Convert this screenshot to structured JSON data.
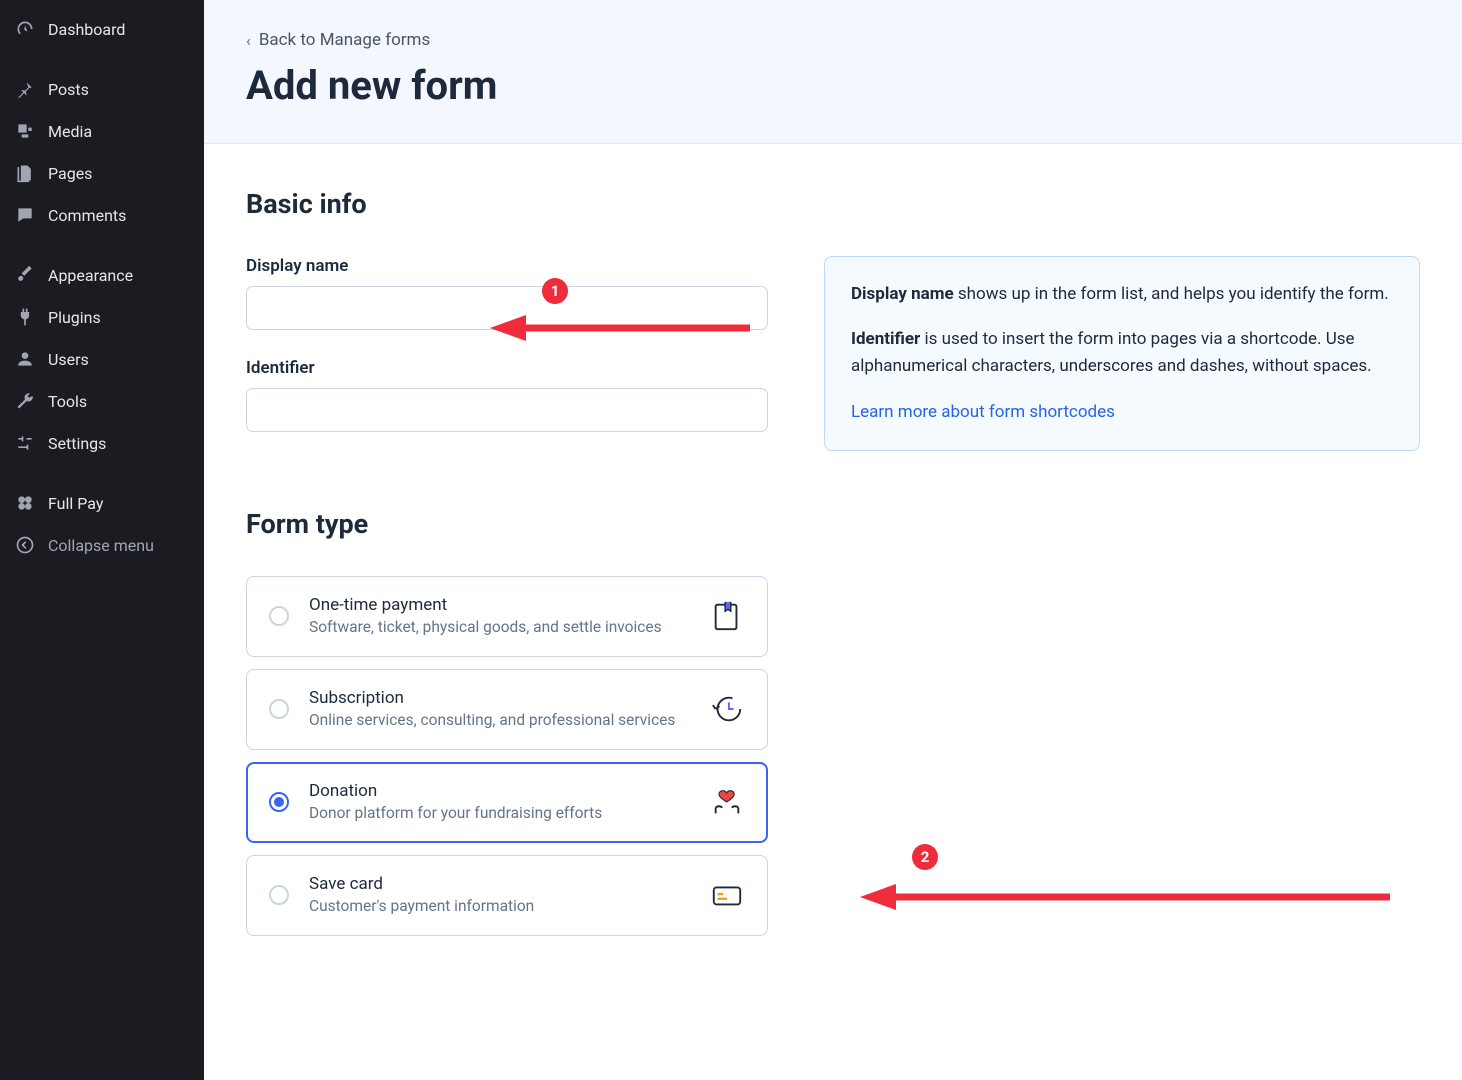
{
  "sidebar": {
    "items": [
      {
        "label": "Dashboard"
      },
      {
        "label": "Posts"
      },
      {
        "label": "Media"
      },
      {
        "label": "Pages"
      },
      {
        "label": "Comments"
      },
      {
        "label": "Appearance"
      },
      {
        "label": "Plugins"
      },
      {
        "label": "Users"
      },
      {
        "label": "Tools"
      },
      {
        "label": "Settings"
      },
      {
        "label": "Full Pay"
      },
      {
        "label": "Collapse menu"
      }
    ]
  },
  "header": {
    "back": "Back to Manage forms",
    "title": "Add new form"
  },
  "basic": {
    "heading": "Basic info",
    "display_name_label": "Display name",
    "display_name_value": "",
    "identifier_label": "Identifier",
    "identifier_value": ""
  },
  "info_box": {
    "p1_bold": "Display name",
    "p1_rest": " shows up in the form list, and helps you identify the form.",
    "p2_bold": "Identifier",
    "p2_rest": " is used to insert the form into pages via a shortcode. Use alphanumerical characters, underscores and dashes, without spaces.",
    "link": "Learn more about form shortcodes"
  },
  "form_type": {
    "heading": "Form type",
    "options": [
      {
        "title": "One-time payment",
        "desc": "Software, ticket, physical goods, and settle invoices",
        "selected": false
      },
      {
        "title": "Subscription",
        "desc": "Online services, consulting, and professional services",
        "selected": false
      },
      {
        "title": "Donation",
        "desc": "Donor platform for your fundraising efforts",
        "selected": true
      },
      {
        "title": "Save card",
        "desc": "Customer's payment information",
        "selected": false
      }
    ]
  },
  "annotations": {
    "badge1": "1",
    "badge2": "2"
  }
}
